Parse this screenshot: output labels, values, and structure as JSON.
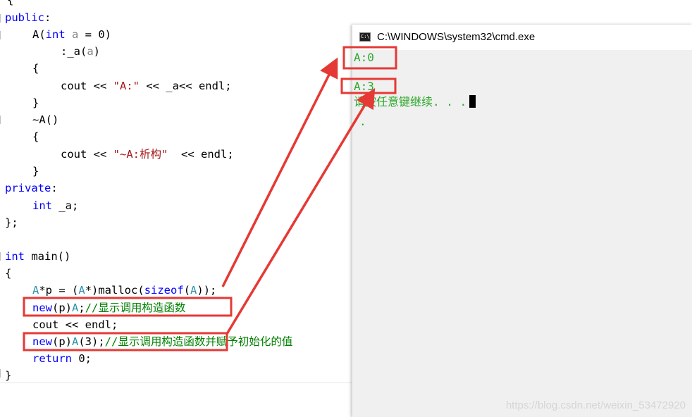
{
  "editor": {
    "lines": {
      "l0": "{",
      "l1_kw": "public",
      "l1_colon": ":",
      "l2_name": "A(",
      "l2_type": "int",
      "l2_param": " a",
      "l2_rest": " = 0)",
      "l3_init": ":_a(",
      "l3_arg": "a",
      "l3_end": ")",
      "l4": "{",
      "l5_cout": "cout << ",
      "l5_str": "\"A:\"",
      "l5_rest": " << _a<< endl;",
      "l6": "}",
      "l7": "~A()",
      "l8": "{",
      "l9_cout": "cout << ",
      "l9_str": "\"~A:析构\"",
      "l9_rest": "  << endl;",
      "l10": "}",
      "l11_kw": "private",
      "l11_colon": ":",
      "l12_type": "int",
      "l12_rest": " _a;",
      "l13": "};",
      "l15_type": "int",
      "l15_rest": " main()",
      "l16": "{",
      "l17_a": "A",
      "l17_b": "*p = (",
      "l17_c": "A",
      "l17_d": "*)malloc(",
      "l17_e": "sizeof",
      "l17_f": "(",
      "l17_g": "A",
      "l17_h": "));",
      "l18_kw": "new",
      "l18_mid": "(p)",
      "l18_cls": "A",
      "l18_semi": ";",
      "l18_cmt": "//显示调用构造函数",
      "l19": "cout << endl;",
      "l20_kw": "new",
      "l20_mid": "(p)",
      "l20_cls": "A",
      "l20_rest": "(3);",
      "l20_cmt": "//显示调用构造函数并赋予初始化的值",
      "l21_kw": "return",
      "l21_rest": " 0;",
      "l22": "}"
    }
  },
  "console": {
    "title": "C:\\WINDOWS\\system32\\cmd.exe",
    "icon_text": "C:\\_",
    "output": {
      "line1": "A:0",
      "line2": "A:3",
      "line3": "请按任意键继续. . .",
      "line4": "."
    }
  },
  "watermark": "https://blog.csdn.net/weixin_53472920",
  "colors": {
    "keyword": "#0000ff",
    "comment": "#008000",
    "string": "#a31515",
    "console_text": "#2ea82e",
    "annotation": "#e53935"
  }
}
